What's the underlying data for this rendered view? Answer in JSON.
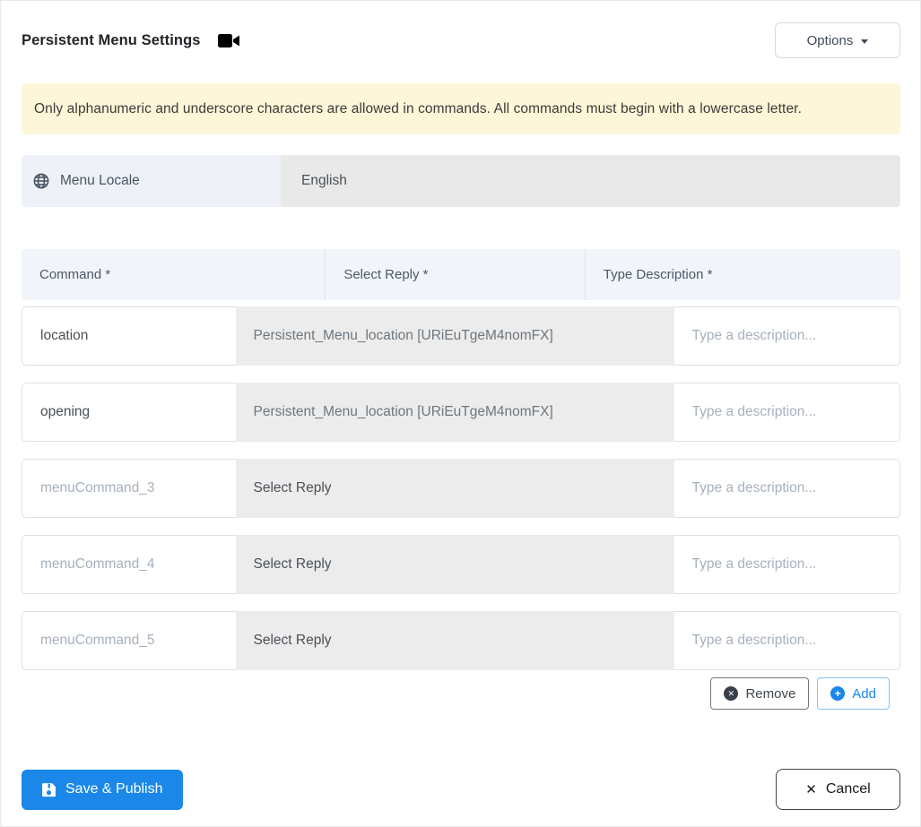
{
  "header": {
    "title": "Persistent Menu Settings",
    "options_label": "Options"
  },
  "banner": {
    "text": "Only alphanumeric and underscore characters are allowed in commands. All commands must begin with a lowercase letter."
  },
  "locale": {
    "label": "Menu Locale",
    "value": "English"
  },
  "table": {
    "headers": [
      "Command *",
      "Select Reply *",
      "Type Description *"
    ],
    "description_placeholder": "Type a description...",
    "rows": [
      {
        "command": "location",
        "reply": "Persistent_Menu_location [URiEuTgeM4nomFX]",
        "filled": true
      },
      {
        "command": "opening",
        "reply": "Persistent_Menu_location [URiEuTgeM4nomFX]",
        "filled": true
      },
      {
        "command": "menuCommand_3",
        "reply": "Select Reply",
        "filled": false
      },
      {
        "command": "menuCommand_4",
        "reply": "Select Reply",
        "filled": false
      },
      {
        "command": "menuCommand_5",
        "reply": "Select Reply",
        "filled": false
      }
    ]
  },
  "row_actions": {
    "remove_label": "Remove",
    "add_label": "Add"
  },
  "footer": {
    "save_label": "Save & Publish",
    "cancel_label": "Cancel"
  },
  "icons": {
    "remove_glyph": "✕",
    "add_glyph": "+",
    "cancel_glyph": "✕"
  },
  "colors": {
    "primary_blue": "#1b87e8",
    "banner_bg": "#fdf6d8",
    "table_header_bg": "#f1f4f9",
    "select_bg": "#ececec",
    "locale_label_bg": "#eef1f7",
    "disabled_input_bg": "#e9e9e9"
  }
}
